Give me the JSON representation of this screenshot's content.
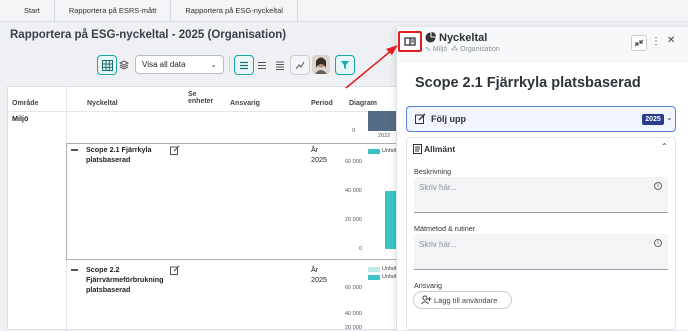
{
  "tabs": [
    "Start",
    "Rapportera på ESRS-mått",
    "Rapportera på ESG-nyckeltal"
  ],
  "page_title": "Rapportera på ESG-nyckeltal - 2025 (Organisation)",
  "toolbar": {
    "filter_select": "Visa all data"
  },
  "table": {
    "headers": {
      "area": "Område",
      "kpi": "Nyckeltal",
      "see_units_1": "Se",
      "see_units_2": "enheter",
      "responsible": "Ansvarig",
      "period": "Period",
      "chart": "Diagram"
    },
    "area_value": "Miljö",
    "chart_top_axis": [
      "0",
      "2022"
    ],
    "rows": [
      {
        "kpi_line1": "Scope 2.1 Fjärrkyla",
        "kpi_line2": "platsbaserad",
        "period_1": "År",
        "period_2": "2025",
        "legend": "Unfall",
        "axis": [
          "60 000",
          "40 000",
          "20 000",
          "0"
        ]
      },
      {
        "kpi_line1": "Scope 2.2",
        "kpi_line2": "Fjärrvärmeförbrukning",
        "kpi_line3": "platsbaserad",
        "period_1": "År",
        "period_2": "2025",
        "legend_1": "Unfall",
        "legend_2": "Unfall",
        "axis": [
          "60 000",
          "40 000",
          "20 000"
        ]
      }
    ]
  },
  "panel": {
    "title": "Nyckeltal",
    "breadcrumb_1": "Miljö",
    "breadcrumb_2": "Organisation",
    "kpi_title": "Scope 2.1 Fjärrkyla platsbaserad",
    "follow_label": "Följ upp",
    "follow_year": "2025",
    "section_title": "Allmänt",
    "description_label": "Beskrivning",
    "description_placeholder": "Skriv här...",
    "method_label": "Mätmetod & rutiner",
    "method_placeholder": "Skriv här...",
    "responsible_label": "Ansvarig",
    "add_user_label": "Lägg till användare"
  },
  "colors": {
    "accent": "#3cc3c3",
    "highlight": "#e02020",
    "follow_border": "#5a7fd6",
    "badge": "#2a3a8c"
  }
}
